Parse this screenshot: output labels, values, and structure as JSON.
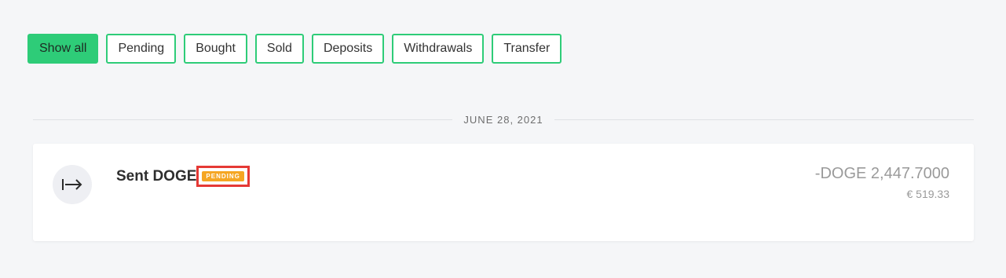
{
  "filters": {
    "show_all": "Show all",
    "pending": "Pending",
    "bought": "Bought",
    "sold": "Sold",
    "deposits": "Deposits",
    "withdrawals": "Withdrawals",
    "transfer": "Transfer"
  },
  "date_group": {
    "label": "JUNE 28, 2021"
  },
  "transaction": {
    "icon": "send-arrow-icon",
    "title": "Sent DOGE",
    "status_badge": "PENDING",
    "crypto_amount": "-DOGE 2,447.7000",
    "fiat_amount": "€ 519.33"
  },
  "colors": {
    "accent": "#2ecc78",
    "badge": "#f5a623",
    "highlight": "#e53935",
    "background": "#f5f6f8"
  }
}
